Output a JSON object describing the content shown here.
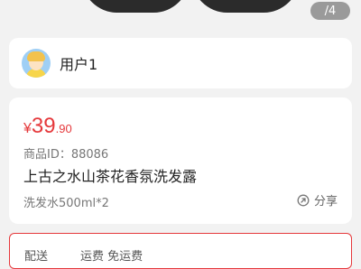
{
  "gallery": {
    "page_indicator": "/4"
  },
  "user": {
    "name": "用户1",
    "avatar_icon": "user-avatar-icon"
  },
  "product": {
    "price_currency": "¥",
    "price_integer": "39",
    "price_decimal": ".90",
    "product_id": "商品ID：88086",
    "name": "上古之水山茶花香氛洗发露",
    "spec": "洗发水500ml*2",
    "share_label": "分享",
    "share_icon": "share-icon"
  },
  "delivery": {
    "label": "配送",
    "value": "运费 免运费"
  },
  "colors": {
    "accent": "#e5383b",
    "background": "#f2f2f2"
  }
}
